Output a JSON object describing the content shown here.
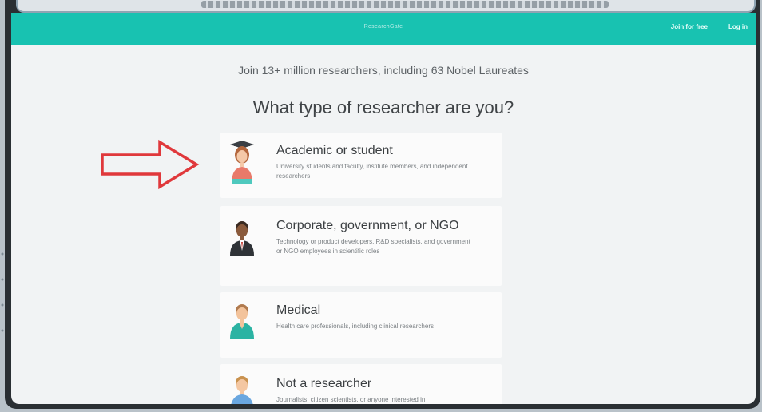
{
  "header": {
    "brand": "ResearchGate",
    "join_free": "Join for free",
    "login": "Log in"
  },
  "stats": "Join 13+ million researchers, including 63 Nobel Laureates",
  "question": "What type of researcher are you?",
  "cards": [
    {
      "title": "Academic or student",
      "desc": "University students and faculty, institute members, and independent researchers",
      "avatar": "academic-avatar-icon"
    },
    {
      "title": "Corporate, government, or NGO",
      "desc": "Technology or product developers, R&D specialists, and government or NGO employees in scientific roles",
      "avatar": "corporate-avatar-icon"
    },
    {
      "title": "Medical",
      "desc": "Health care professionals, including clinical researchers",
      "avatar": "medical-avatar-icon"
    },
    {
      "title": "Not a researcher",
      "desc": "Journalists, citizen scientists, or anyone interested in",
      "avatar": "non-researcher-avatar-icon"
    }
  ],
  "colors": {
    "topbar": "#18c2b1",
    "arrow": "#e0383b",
    "page_bg": "#f1f3f4"
  }
}
